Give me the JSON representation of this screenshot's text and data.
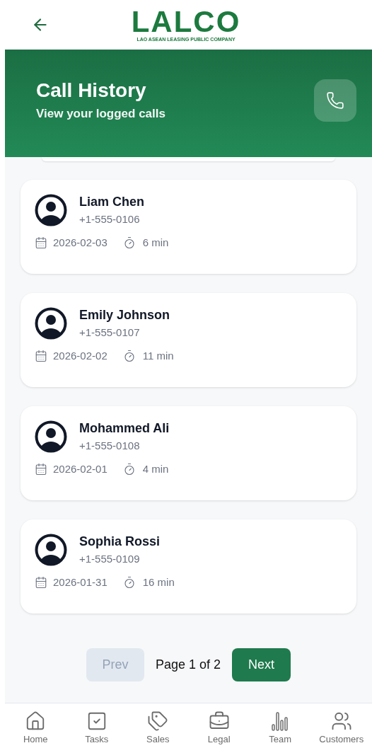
{
  "logo": {
    "name": "LALCO",
    "tagline": "LAO ASEAN LEASING PUBLIC COMPANY"
  },
  "header": {
    "title": "Call History",
    "subtitle": "View your logged calls"
  },
  "calls": [
    {
      "name": "Liam Chen",
      "phone": "+1-555-0106",
      "date": "2026-02-03",
      "duration": "6 min"
    },
    {
      "name": "Emily Johnson",
      "phone": "+1-555-0107",
      "date": "2026-02-02",
      "duration": "11 min"
    },
    {
      "name": "Mohammed Ali",
      "phone": "+1-555-0108",
      "date": "2026-02-01",
      "duration": "4 min"
    },
    {
      "name": "Sophia Rossi",
      "phone": "+1-555-0109",
      "date": "2026-01-31",
      "duration": "16 min"
    }
  ],
  "pagination": {
    "prev": {
      "label": "Prev",
      "disabled": true
    },
    "page": "Page 1 of 2",
    "next": {
      "label": "Next",
      "disabled": false
    }
  },
  "nav": [
    {
      "kind": "home",
      "label": "Home"
    },
    {
      "kind": "tasks",
      "label": "Tasks"
    },
    {
      "kind": "sales",
      "label": "Sales"
    },
    {
      "kind": "legal",
      "label": "Legal"
    },
    {
      "kind": "team",
      "label": "Team"
    },
    {
      "kind": "customers",
      "label": "Customers"
    }
  ]
}
